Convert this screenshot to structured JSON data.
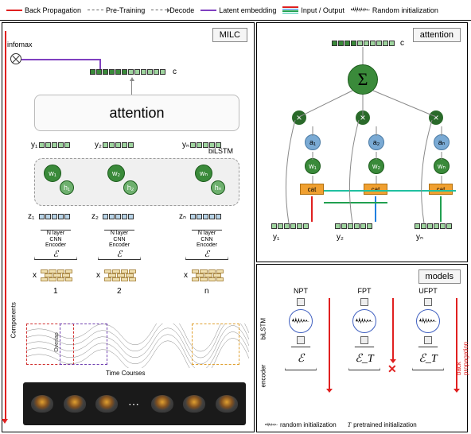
{
  "legend": {
    "backprop": "Back Propagation",
    "pretrain": "Pre-Training",
    "decode": "Decode",
    "latent": "Latent embedding",
    "io": "Input / Output",
    "randinit": "Random initialization"
  },
  "panels": {
    "milc": "MILC",
    "attention": "attention",
    "models": "models"
  },
  "left": {
    "infomax": "infomax",
    "c": "c",
    "attention_box": "attention",
    "bilstm": "biLSTM",
    "y": [
      "y₁",
      "y₂",
      "yₙ"
    ],
    "w": [
      "w₁",
      "w₂",
      "wₙ"
    ],
    "h": [
      "h₁",
      "h₂",
      "hₙ"
    ],
    "z": [
      "z₁",
      "z₂",
      "zₙ"
    ],
    "x": [
      "x",
      "x",
      "x"
    ],
    "idx": [
      "1",
      "2",
      "n"
    ],
    "encoder_lines": [
      "N layer",
      "CNN",
      "Encoder"
    ],
    "enc_symbol": "ℰ",
    "components": "Components",
    "overlap": "Overlap",
    "timecourses": "Time Courses"
  },
  "right_top": {
    "c": "c",
    "sigma": "Σ",
    "mult": "×",
    "a": [
      "a₁",
      "a₂",
      "aₙ"
    ],
    "w": [
      "w₁",
      "w₂",
      "wₙ"
    ],
    "cat": "cat",
    "y": [
      "y₁",
      "y₂",
      "yₙ"
    ]
  },
  "right_bot": {
    "titles": [
      "NPT",
      "FPT",
      "UFPT"
    ],
    "enc": [
      "ℰ",
      "ℰ_T",
      "ℰ_T"
    ],
    "bilstm": "biLSTM",
    "encoder": "encoder",
    "backprop_side": "back propagation",
    "randinit": "random initialization",
    "pretrained": "pretrained initialization",
    "T": "T"
  },
  "colors": {
    "backprop": "#e02020",
    "pretrain": "#999999",
    "latent": "#8040c0",
    "io1": "#e02020",
    "io2": "#2080e0",
    "io3": "#20a050",
    "io4": "#20c0a0"
  }
}
